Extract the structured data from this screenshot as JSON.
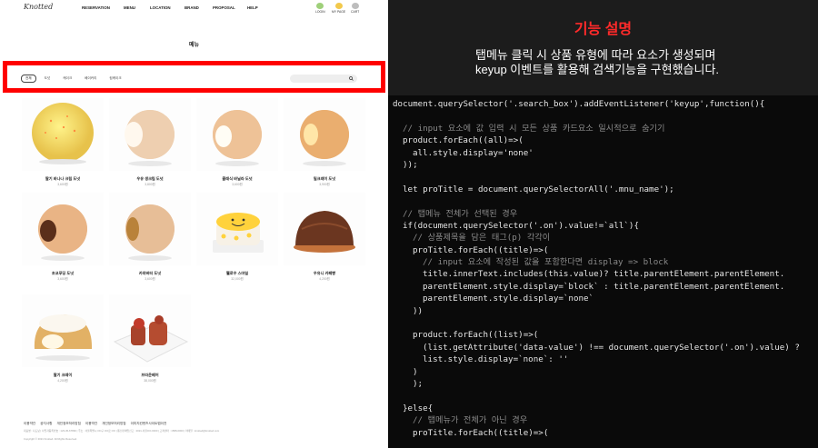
{
  "site": {
    "logo": "Knotted",
    "nav": [
      "RESERVATION",
      "MENU",
      "LOCATION",
      "BRAND",
      "PROPOSAL",
      "HELP"
    ],
    "util": [
      {
        "label": "LOGIN",
        "color": "#9fd07a"
      },
      {
        "label": "MY PAGE",
        "color": "#f2c94c"
      },
      {
        "label": "CART",
        "color": "#bdbdbd"
      }
    ],
    "page_title": "메뉴",
    "tabs": [
      {
        "label": "전체",
        "active": true
      },
      {
        "label": "도넛",
        "active": false
      },
      {
        "label": "케이크",
        "active": false
      },
      {
        "label": "베이커리",
        "active": false
      },
      {
        "label": "컴케이크",
        "active": false
      }
    ],
    "search": {
      "placeholder": ""
    },
    "products": [
      {
        "name": "딸기 바나나 크림 도넛",
        "price": "3,600원",
        "kind": "yellow-donut"
      },
      {
        "name": "우유 생크림 도넛",
        "price": "3,800원",
        "kind": "cream-donut"
      },
      {
        "name": "클래식 바닐라 도넛",
        "price": "3,600원",
        "kind": "vanilla-donut"
      },
      {
        "name": "밀크레이 도넛",
        "price": "3,900원",
        "kind": "orange-donut"
      },
      {
        "name": "초코푸딩 도넛",
        "price": "3,600원",
        "kind": "choco-donut"
      },
      {
        "name": "카야버터 도넛",
        "price": "3,600원",
        "kind": "kaya-donut"
      },
      {
        "name": "웰로우 스마일",
        "price": "32,000원",
        "kind": "smile-cake"
      },
      {
        "name": "우유니 카페빵",
        "price": "4,200원",
        "kind": "cafe-bread"
      },
      {
        "name": "딸기 크레이",
        "price": "4,200원",
        "kind": "cream-bun"
      },
      {
        "name": "브라운베어",
        "price": "38,000원",
        "kind": "bear-cake"
      }
    ],
    "footer": {
      "links": [
        "이용약관",
        "공지사항",
        "개인정보처리방침",
        "이용약관",
        "개인정보처리방침",
        "이미지컨텐츠사이트맵이전"
      ],
      "info": "대표명 : 나도넛 | 사업자등록번호 : 123-45-67890 | 주소 : 서울특별시 OO구 OO로 OO | 통신판매업신고 : 2021-서울OO-0000 | 고객센터 : 1588-0000 | 이메일 : knotted@knotted.com",
      "copyright": "Copyright © 2021 Knotted. All Rights Reserved."
    }
  },
  "explain": {
    "title": "기능 설명",
    "description": "탭메뉴 클릭 시 상품 유형에 따라 요소가 생성되며 keyup 이벤트를 활용해 검색기능을 구현했습니다."
  },
  "code_lines": [
    {
      "i": 0,
      "t": "document.querySelector('.search_box').addEventListener('keyup',function(){"
    },
    {
      "i": 0,
      "t": ""
    },
    {
      "i": 1,
      "t": "// input 요소에 값 입력 시 모든 상품 카드요소 일시적으로 숨기기",
      "cm": true
    },
    {
      "i": 1,
      "t": "product.forEach((all)=>("
    },
    {
      "i": 2,
      "t": "all.style.display='none'"
    },
    {
      "i": 1,
      "t": "));"
    },
    {
      "i": 0,
      "t": ""
    },
    {
      "i": 1,
      "t": "let proTitle = document.querySelectorAll('.mnu_name');"
    },
    {
      "i": 0,
      "t": ""
    },
    {
      "i": 1,
      "t": "// 탭메뉴 전체가 선택된 경우",
      "cm": true
    },
    {
      "i": 1,
      "t": "if(document.querySelector('.on').value!=`all`){"
    },
    {
      "i": 2,
      "t": "// 상품제목을 담은 태그(p) 각각이",
      "cm": true
    },
    {
      "i": 2,
      "t": "proTitle.forEach((title)=>("
    },
    {
      "i": 3,
      "t": "// input 요소에 작성된 값을 포함한다면 display => block",
      "cm": true
    },
    {
      "i": 3,
      "t": "title.innerText.includes(this.value)? title.parentElement.parentElement."
    },
    {
      "i": 3,
      "t": "parentElement.style.display=`block` : title.parentElement.parentElement."
    },
    {
      "i": 3,
      "t": "parentElement.style.display=`none`"
    },
    {
      "i": 2,
      "t": "))"
    },
    {
      "i": 0,
      "t": ""
    },
    {
      "i": 2,
      "t": "product.forEach((list)=>("
    },
    {
      "i": 3,
      "t": "(list.getAttribute('data-value') !== document.querySelector('.on').value) ?"
    },
    {
      "i": 3,
      "t": "list.style.display=`none`: ''"
    },
    {
      "i": 2,
      "t": ")"
    },
    {
      "i": 2,
      "t": ");"
    },
    {
      "i": 0,
      "t": ""
    },
    {
      "i": 1,
      "t": "}else{"
    },
    {
      "i": 2,
      "t": "// 탭메뉴가 전체가 아닌 경우",
      "cm": true
    },
    {
      "i": 2,
      "t": "proTitle.forEach((title)=>("
    }
  ]
}
